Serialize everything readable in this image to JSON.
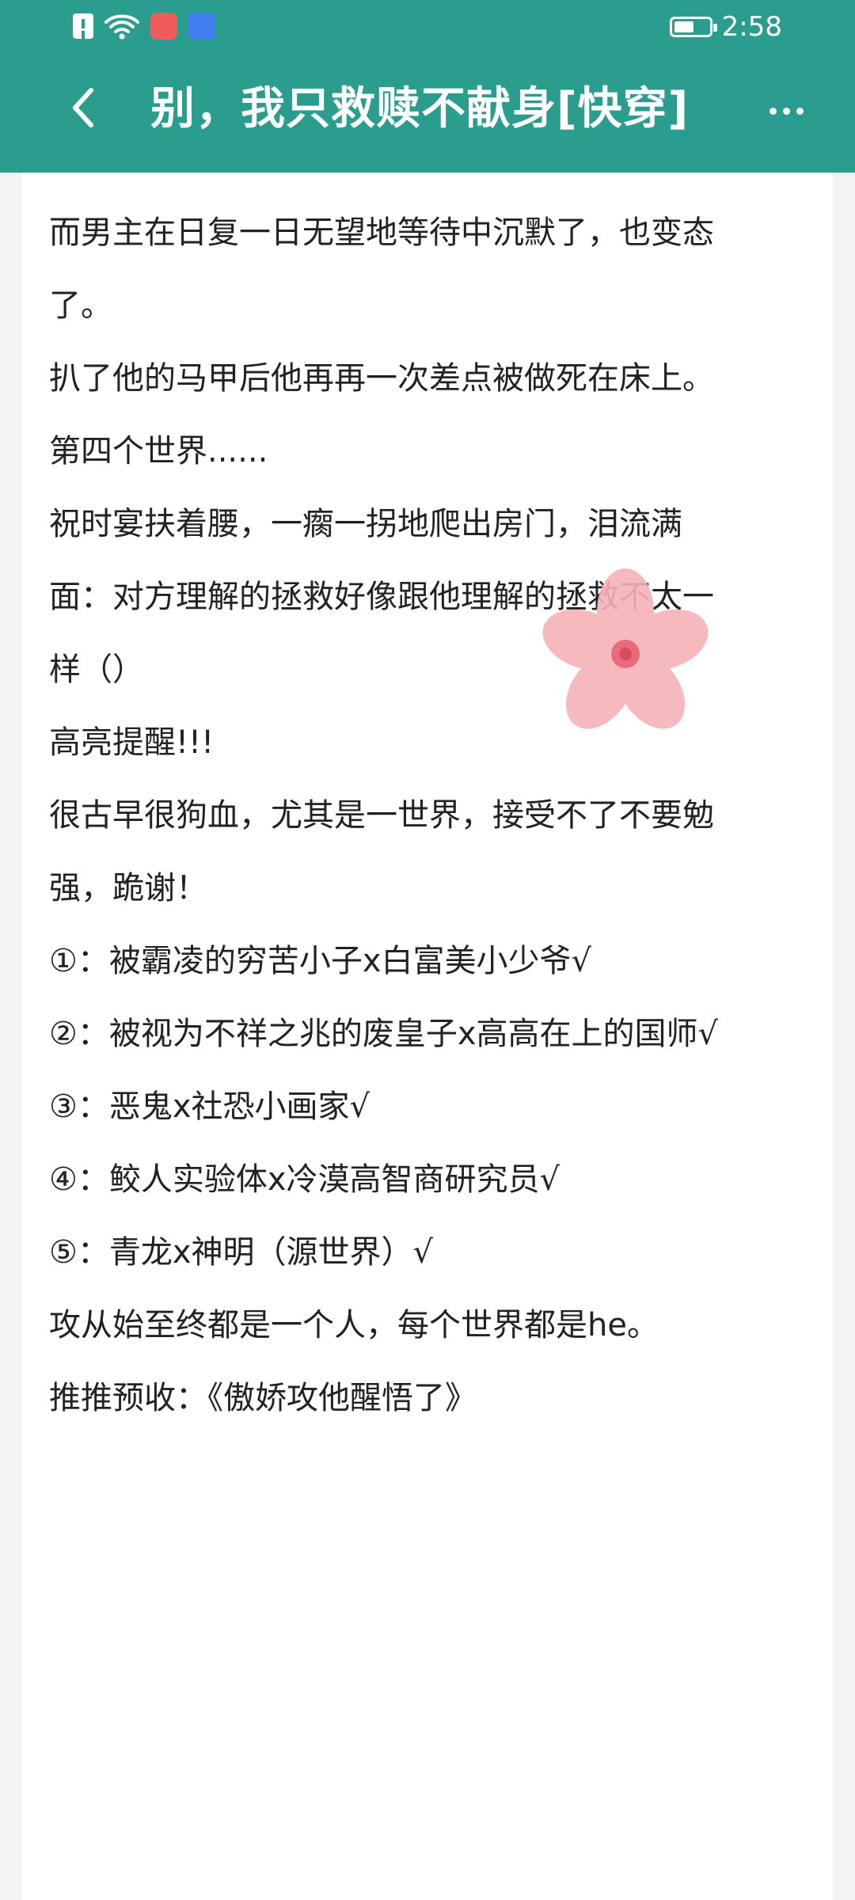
{
  "status_bar": {
    "time": "2:58",
    "icons": [
      "sim-icon",
      "wifi-icon",
      "huawei-app-icon",
      "store-app-icon",
      "battery-icon"
    ]
  },
  "title_bar": {
    "title": "别，我只救赎不献身[快穿]",
    "back_icon": "chevron-left-icon",
    "more_icon": "more-horizontal-icon"
  },
  "content": {
    "lines": [
      "而男主在日复一日无望地等待中沉默了，也变态",
      "了。",
      "",
      "扒了他的马甲后他再再一次差点被做死在床上。",
      "",
      "第四个世界......",
      "",
      "祝时宴扶着腰，一瘸一拐地爬出房门，泪流满",
      "面：对方理解的拯救好像跟他理解的拯救不太一",
      "样（）",
      "",
      "高亮提醒!!!",
      "很古早很狗血，尤其是一世界，接受不了不要勉",
      "强，跪谢！",
      "",
      "①：被霸凌的穷苦小子x白富美小少爷√",
      "②：被视为不祥之兆的废皇子x高高在上的国师√",
      "③：恶鬼x社恐小画家√",
      "④：鲛人实验体x冷漠高智商研究员√",
      "⑤：青龙x神明（源世界）√",
      "",
      "攻从始至终都是一个人，每个世界都是he。",
      "",
      "推推预收：《傲娇攻他醒悟了》"
    ]
  },
  "colors": {
    "header_bg": "#2a9d8f",
    "page_bg": "#f3f3f3",
    "card_bg": "#ffffff",
    "text": "#222222"
  }
}
